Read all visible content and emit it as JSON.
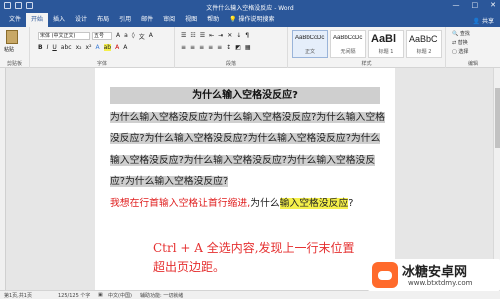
{
  "window": {
    "title": "文件什么输入空格没反应 - Word"
  },
  "tabs": [
    "文件",
    "开始",
    "插入",
    "设计",
    "布局",
    "引用",
    "邮件",
    "审阅",
    "视图",
    "帮助"
  ],
  "tell_me": "操作说明搜索",
  "share_label": "共享",
  "ribbon": {
    "clipboard": {
      "paste": "粘贴",
      "label": "剪贴板"
    },
    "font": {
      "name": "宋体 (中文正文)",
      "size": "五号",
      "label": "字体"
    },
    "paragraph": {
      "label": "段落"
    },
    "styles": {
      "items": [
        {
          "sample": "AaBbCcDc",
          "name": "正文"
        },
        {
          "sample": "AaBbCcDc",
          "name": "无间隔"
        },
        {
          "sample": "AaBl",
          "name": "标题 1"
        },
        {
          "sample": "AaBbC",
          "name": "标题 2"
        }
      ],
      "label": "样式"
    },
    "editing": {
      "find": "查找",
      "replace": "替换",
      "select": "选择",
      "label": "编辑"
    }
  },
  "document": {
    "title": "为什么输入空格没反应?",
    "paragraph": "为什么输入空格没反应?为什么输入空格没反应?为什么输入空格没反应?为什么输入空格没反应?为什么输入空格没反应?为什么输入空格没反应?为什么输入空格没反应?为什么输入空格没反应?为什么输入空格没反应?",
    "red_text": "我想在行首输入空格让首行缩进,",
    "normal_text": "为什么",
    "yellow_text": "输入空格没反应",
    "end_text": "?",
    "annotation_line1": "Ctrl + A 全选内容,发现上一行末位置",
    "annotation_line2": "超出页边距。"
  },
  "status": {
    "page": "第1页,共1页",
    "words": "125/125 个字",
    "lang": "中文(中国)",
    "accessibility": "辅助功能: 一切就绪"
  },
  "watermark": {
    "name": "冰糖安卓网",
    "url": "www.btxtdmy.com"
  },
  "colors": {
    "word_blue": "#2b579a",
    "selection_gray": "#cfcfcf",
    "red_text": "#e02020",
    "yellow_highlight": "#f5f04a"
  }
}
